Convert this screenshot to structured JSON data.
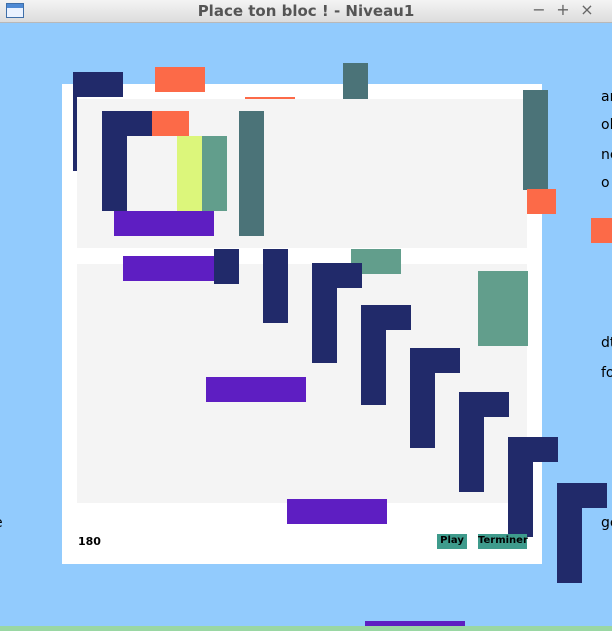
{
  "window": {
    "title": "Place ton bloc ! - Niveau1",
    "controls": [
      "−",
      "+",
      "×"
    ]
  },
  "game": {
    "score": "180",
    "play_label": "Play",
    "finish_label": "Terminer"
  },
  "edge_text": {
    "right": [
      "ar",
      "ol",
      "ne",
      "o",
      "e",
      "dt",
      "fo",
      "ge"
    ],
    "left": [
      "e"
    ]
  },
  "colors": {
    "background": "#92cbfd",
    "board": "#ffffff",
    "zone": "#f4f4f4",
    "navy": "#212a6a",
    "purple": "#5e1ec2",
    "orange": "#fc6a48",
    "teal": "#4b7378",
    "sage": "#629e8c",
    "lime": "#dcf67b",
    "button": "#3e9b8c"
  }
}
